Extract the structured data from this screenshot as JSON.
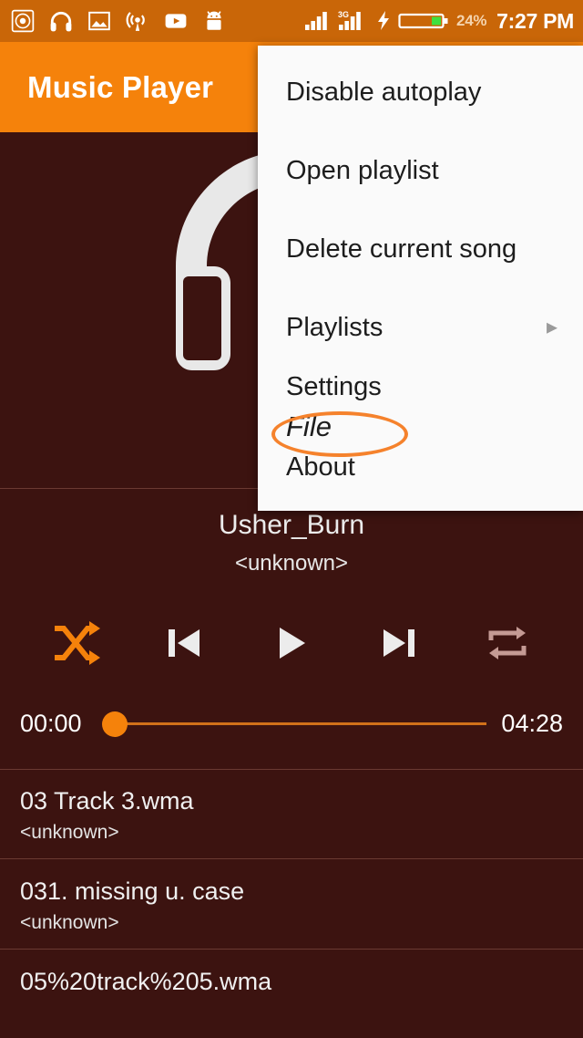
{
  "statusbar": {
    "icons": [
      {
        "name": "disc-icon"
      },
      {
        "name": "headphones-icon"
      },
      {
        "name": "image-icon"
      },
      {
        "name": "broadcast-icon"
      },
      {
        "name": "youtube-icon"
      },
      {
        "name": "android-robot-icon"
      }
    ],
    "network_label": "3G",
    "battery_percent": "24%",
    "time": "7:27 PM"
  },
  "appbar": {
    "title": "Music Player"
  },
  "album_art": {
    "icon": "headphones-placeholder-icon"
  },
  "now_playing": {
    "title": "Usher_Burn",
    "artist": "<unknown>"
  },
  "controls": {
    "shuffle": "shuffle-icon",
    "previous": "previous-track-icon",
    "play": "play-icon",
    "next": "next-track-icon",
    "repeat": "repeat-icon"
  },
  "seek": {
    "current_time": "00:00",
    "total_time": "04:28",
    "progress_percent": 0
  },
  "tracks": [
    {
      "title": "03 Track 3.wma",
      "artist": "<unknown>"
    },
    {
      "title": "031. missing u. case",
      "artist": "<unknown>"
    },
    {
      "title": "05%20track%205.wma",
      "artist": ""
    }
  ],
  "menu": {
    "items": [
      {
        "label": "Disable autoplay",
        "arrow": ""
      },
      {
        "label": "Open playlist",
        "arrow": ""
      },
      {
        "label": "Delete current song",
        "arrow": ""
      },
      {
        "label": "Playlists",
        "arrow": "▸"
      },
      {
        "label": "Settings",
        "arrow": ""
      },
      {
        "label": "File",
        "arrow": ""
      },
      {
        "label": "About",
        "arrow": ""
      }
    ]
  },
  "colors": {
    "accent_orange": "#f5820b",
    "statusbar_orange": "#c96608",
    "background_maroon": "#3c1310",
    "annotation_orange": "#f5822c",
    "battery_green": "#3fe03f"
  }
}
